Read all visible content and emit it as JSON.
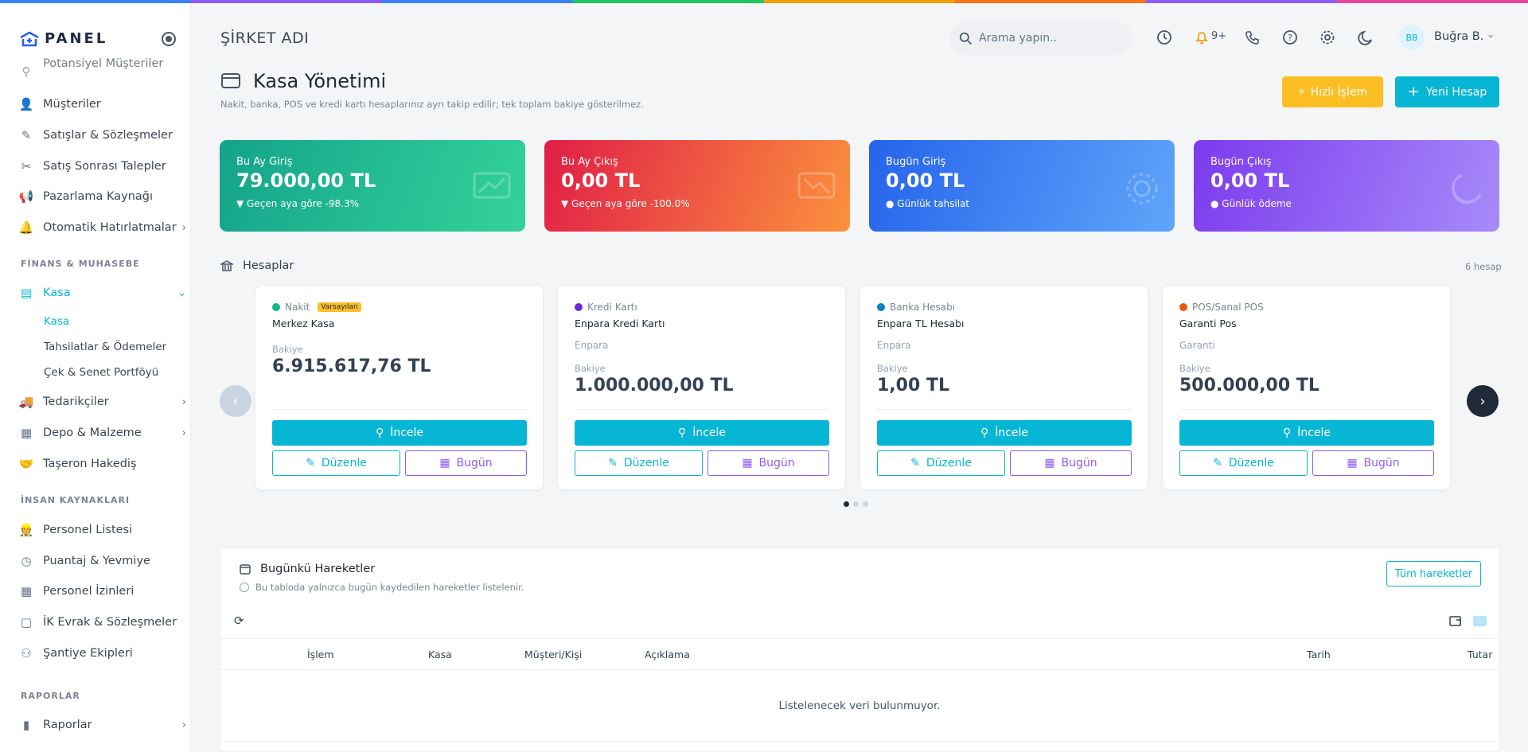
{
  "top_bar_colors": [
    "#3b82f6",
    "#8b5cf6",
    "#3b82f6",
    "#22c55e",
    "#f59e0b",
    "#f97316",
    "#8b5cf6",
    "#ec4899"
  ],
  "brand": {
    "name": "PANEL",
    "accent": "#06b6d4"
  },
  "sidebar": {
    "partial_item": "Potansiyel Müşteriler",
    "items_top": [
      {
        "label": "Müşteriler",
        "icon": "users-icon"
      },
      {
        "label": "Satışlar & Sözleşmeler",
        "icon": "contract-icon"
      },
      {
        "label": "Satış Sonrası Talepler",
        "icon": "tools-icon"
      },
      {
        "label": "Pazarlama Kaynağı",
        "icon": "megaphone-icon"
      },
      {
        "label": "Otomatik Hatırlatmalar",
        "icon": "bell-icon"
      }
    ],
    "section_finance": "FİNANS & MUHASEBE",
    "kasa": {
      "label": "Kasa",
      "subs": [
        "Kasa",
        "Tahsilatlar & Ödemeler",
        "Çek & Senet Portföyü"
      ]
    },
    "items_finance": [
      {
        "label": "Tedarikçiler",
        "icon": "truck-icon"
      },
      {
        "label": "Depo & Malzeme",
        "icon": "warehouse-icon"
      },
      {
        "label": "Taşeron Hakediş",
        "icon": "handshake-icon"
      }
    ],
    "section_hr": "İNSAN KAYNAKLARI",
    "items_hr": [
      {
        "label": "Personel Listesi",
        "icon": "person-icon"
      },
      {
        "label": "Puantaj & Yevmiye",
        "icon": "clock-icon"
      },
      {
        "label": "Personel İzinleri",
        "icon": "calendar-icon"
      },
      {
        "label": "İK Evrak & Sözleşmeler",
        "icon": "document-icon"
      },
      {
        "label": "Şantiye Ekipleri",
        "icon": "team-icon"
      }
    ],
    "section_reports": "RAPORLAR",
    "reports": {
      "label": "Raporlar",
      "icon": "chart-icon"
    }
  },
  "topbar": {
    "company": "ŞİRKET ADI",
    "search_placeholder": "Arama yapın..",
    "notif_count": "9+",
    "user_initials": "BB",
    "user_name": "Buğra B."
  },
  "header": {
    "title": "Kasa Yönetimi",
    "subtitle": "Nakit, banka, POS ve kredi kartı hesaplarınız ayrı takip edilir; tek toplam bakiye gösterilmez.",
    "quick_btn": "Hızlı İşlem",
    "new_btn": "Yeni Hesap"
  },
  "stats": [
    {
      "label": "Bu Ay Giriş",
      "value": "79.000,00 TL",
      "sub": "▼ Geçen aya göre -98.3%",
      "gradient": [
        "#14a38b",
        "#34d399"
      ],
      "icon": "trend-up-icon"
    },
    {
      "label": "Bu Ay Çıkış",
      "value": "0,00 TL",
      "sub": "▼ Geçen aya göre -100.0%",
      "gradient": [
        "#e11d48",
        "#fb923c"
      ],
      "icon": "trend-down-icon"
    },
    {
      "label": "Bugün Giriş",
      "value": "0,00 TL",
      "sub": "● Günlük tahsilat",
      "gradient": [
        "#2563eb",
        "#60a5fa"
      ],
      "icon": "sun-icon"
    },
    {
      "label": "Bugün Çıkış",
      "value": "0,00 TL",
      "sub": "● Günlük ödeme",
      "gradient": [
        "#7c3aed",
        "#a78bfa"
      ],
      "icon": "moon-icon"
    }
  ],
  "accounts": {
    "title": "Hesaplar",
    "count": "6 hesap",
    "balance_label": "Bakiye",
    "inspect_label": "İncele",
    "edit_label": "Düzenle",
    "today_label": "Bugün",
    "default_badge": "Varsayılan",
    "cards": [
      {
        "type": "Nakit",
        "dot": "#10b981",
        "name": "Merkez Kasa",
        "bank": "",
        "balance": "6.915.617,76 TL",
        "is_default": true
      },
      {
        "type": "Kredi Kartı",
        "dot": "#6d28d9",
        "name": "Enpara Kredi Kartı",
        "bank": "Enpara",
        "balance": "1.000.000,00 TL",
        "is_default": false
      },
      {
        "type": "Banka Hesabı",
        "dot": "#0284c7",
        "name": "Enpara TL Hesabı",
        "bank": "Enpara",
        "balance": "1,00 TL",
        "is_default": false
      },
      {
        "type": "POS/Sanal POS",
        "dot": "#ea580c",
        "name": "Garanti Pos",
        "bank": "Garanti",
        "balance": "500.000,00 TL",
        "is_default": false
      }
    ]
  },
  "today": {
    "title": "Bugünkü Hareketler",
    "note": "Bu tabloda yalnızca bugün kaydedilen hareketler listelenir.",
    "all_btn": "Tüm hareketler",
    "columns": [
      "İşlem",
      "Kasa",
      "Müşteri/Kişi",
      "Açıklama",
      "Tarih",
      "Tutar"
    ],
    "empty": "Listelenecek veri bulunmuyor."
  }
}
